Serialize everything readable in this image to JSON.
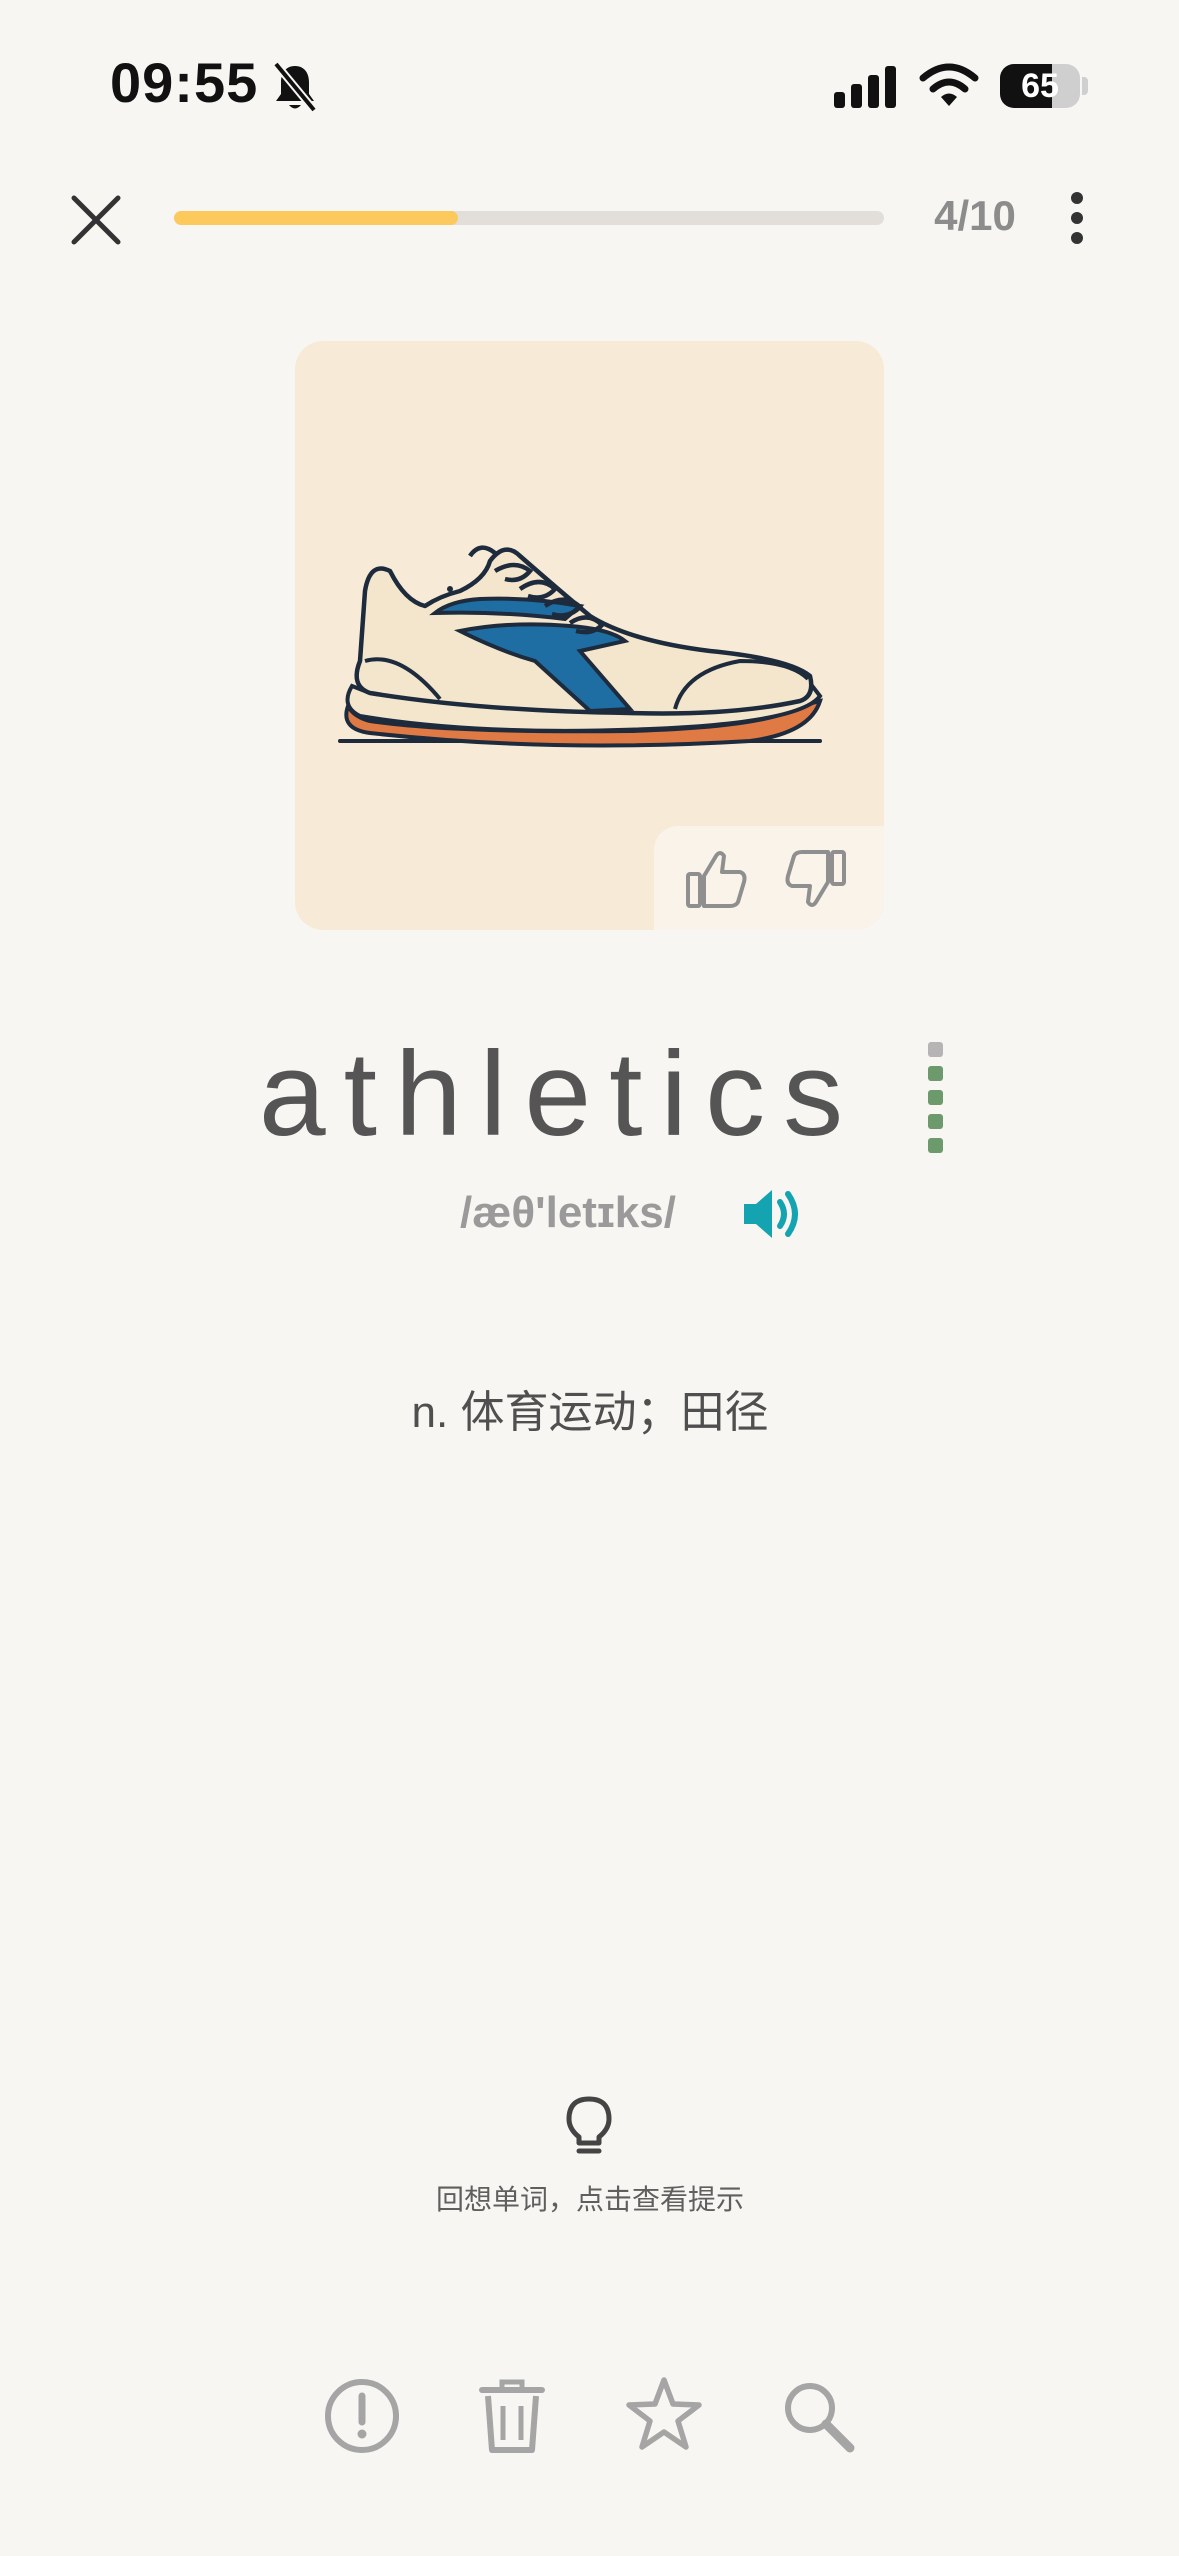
{
  "status_bar": {
    "time": "09:55",
    "battery_level": "65",
    "battery_percent": 0.65,
    "icons": [
      "bell-muted-icon",
      "cellular-signal-icon",
      "wifi-icon",
      "battery-icon"
    ]
  },
  "top_bar": {
    "progress_label": "4/10",
    "progress_fraction": 0.4,
    "icons": [
      "close-icon",
      "more-vertical-icon"
    ]
  },
  "card": {
    "image": "running-shoe-illustration",
    "rating_icons": [
      "thumbs-up-icon",
      "thumbs-down-icon"
    ]
  },
  "word": {
    "text": "athletics",
    "phonetic": "/æθ'letɪks/",
    "level_filled": 4,
    "level_total": 5,
    "definition": "n. 体育运动；田径"
  },
  "hint": {
    "text": "回想单词，点击查看提示",
    "icon": "lightbulb-icon"
  },
  "toolbar": {
    "icons": [
      "report-icon",
      "trash-icon",
      "star-icon",
      "search-icon"
    ]
  },
  "colors": {
    "accent_progress": "#fbc95c",
    "speaker_teal": "#13a3b1",
    "level_green": "#6c9a6c",
    "level_gray": "#b5b5b5",
    "icon_gray": "#a5a5a5",
    "card_bg": "#f7ebd7"
  }
}
